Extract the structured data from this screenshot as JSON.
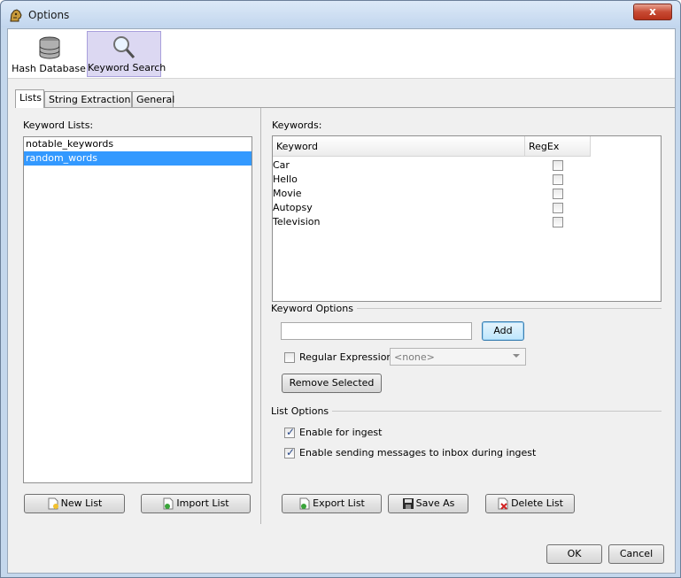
{
  "window": {
    "title": "Options",
    "close_label": "x"
  },
  "toolbar": {
    "items": [
      {
        "label": "Hash Database",
        "icon": "database-icon"
      },
      {
        "label": "Keyword Search",
        "icon": "magnifier-icon"
      }
    ]
  },
  "tabs": [
    {
      "label": "Lists"
    },
    {
      "label": "String Extraction"
    },
    {
      "label": "General"
    }
  ],
  "lists_panel": {
    "heading": "Keyword Lists:",
    "items": [
      "notable_keywords",
      "random_words"
    ],
    "selected_index": 1,
    "new_list_label": "New List",
    "import_list_label": "Import List"
  },
  "keywords_panel": {
    "heading": "Keywords:",
    "columns": [
      "Keyword",
      "RegEx"
    ],
    "rows": [
      {
        "keyword": "Car",
        "regex": false
      },
      {
        "keyword": "Hello",
        "regex": false
      },
      {
        "keyword": "Movie",
        "regex": false
      },
      {
        "keyword": "Autopsy",
        "regex": false
      },
      {
        "keyword": "Television",
        "regex": false
      }
    ]
  },
  "keyword_options": {
    "title": "Keyword Options",
    "input_value": "",
    "add_label": "Add",
    "regex_label": "Regular Expression",
    "regex_checked": false,
    "combo_value": "<none>",
    "remove_label": "Remove Selected"
  },
  "list_options": {
    "title": "List Options",
    "enable_ingest_label": "Enable for ingest",
    "enable_ingest_checked": true,
    "enable_messages_label": "Enable sending messages to inbox during ingest",
    "enable_messages_checked": true
  },
  "actions": {
    "export_label": "Export List",
    "save_as_label": "Save As",
    "delete_label": "Delete List"
  },
  "dialog": {
    "ok_label": "OK",
    "cancel_label": "Cancel"
  },
  "colors": {
    "selection": "#3399ff",
    "tab_active_bg": "#ffffff",
    "toolbar_selected": "#dcd8f2"
  }
}
